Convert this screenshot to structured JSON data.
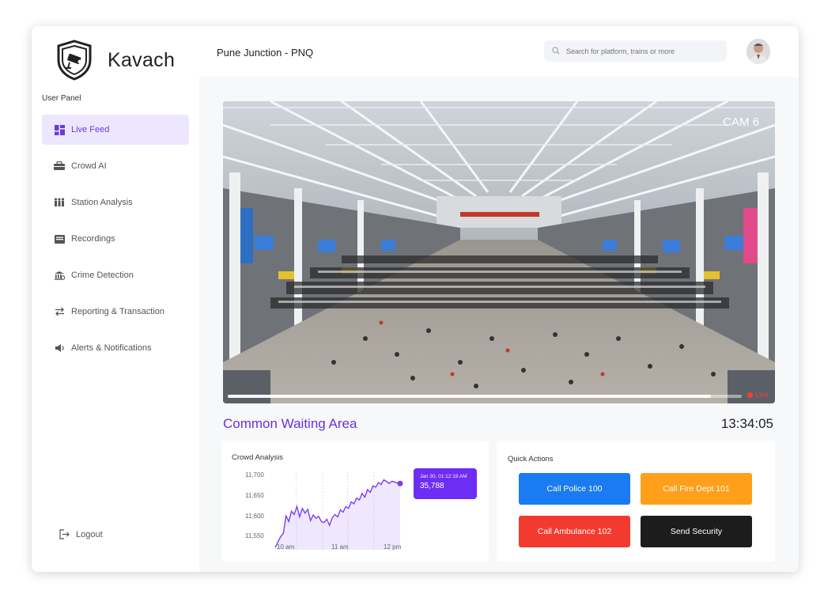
{
  "app": {
    "name": "Kavach"
  },
  "sidebar": {
    "panel_label": "User Panel",
    "items": [
      {
        "label": "Live Feed",
        "icon": "dashboard-icon",
        "active": true
      },
      {
        "label": "Crowd AI",
        "icon": "crowd-icon"
      },
      {
        "label": "Station Analysis",
        "icon": "people-analysis-icon"
      },
      {
        "label": "Recordings",
        "icon": "recordings-icon"
      },
      {
        "label": "Crime Detection",
        "icon": "crime-icon"
      },
      {
        "label": "Reporting & Transaction",
        "icon": "swap-arrows-icon"
      },
      {
        "label": "Alerts & Notifications",
        "icon": "alert-icon"
      }
    ],
    "logout_label": "Logout"
  },
  "header": {
    "station": "Pune Junction - PNQ",
    "search_placeholder": "Search for platform, trains or more"
  },
  "feed": {
    "camera": "CAM 6",
    "live_label": "Live",
    "progress": 0.94,
    "area": "Common Waiting Area",
    "time": "13:34:05"
  },
  "crowd": {
    "title": "Crowd Analysis",
    "tooltip_date": "Jan 30, 01:12:18 AM",
    "tooltip_value": "35,788",
    "chart_data": {
      "type": "area",
      "x": [
        0.0,
        0.1,
        0.15,
        0.2,
        0.25,
        0.3,
        0.35,
        0.4,
        0.45,
        0.5,
        0.55,
        0.6,
        0.65,
        0.7,
        0.75,
        0.8,
        0.85,
        0.9,
        0.95,
        1.0,
        1.05,
        1.1,
        1.15,
        1.2,
        1.25,
        1.3,
        1.35,
        1.4,
        1.45,
        1.5,
        1.55,
        1.6,
        1.65,
        1.7,
        1.75,
        1.8,
        1.85,
        1.9,
        1.95,
        2.0,
        2.05,
        2.1,
        2.15,
        2.2,
        2.25,
        2.3
      ],
      "values": [
        11545,
        11568,
        11575,
        11612,
        11600,
        11622,
        11615,
        11632,
        11610,
        11628,
        11618,
        11626,
        11602,
        11614,
        11607,
        11611,
        11600,
        11598,
        11605,
        11592,
        11608,
        11615,
        11610,
        11625,
        11620,
        11632,
        11628,
        11642,
        11638,
        11650,
        11646,
        11660,
        11652,
        11668,
        11662,
        11676,
        11673,
        11683,
        11679,
        11689,
        11685,
        11681,
        11686,
        11684,
        11682,
        11681
      ],
      "xticks": [
        "10 am",
        "11 am",
        "12 pm"
      ],
      "yticks": [
        "11,700",
        "11,650",
        "11,600",
        "11,550"
      ],
      "ylim": [
        11540,
        11705
      ],
      "color": "#7b3ff2"
    }
  },
  "actions": {
    "title": "Quick Actions",
    "buttons": [
      {
        "label": "Call Police 100",
        "color": "#1a7bf2"
      },
      {
        "label": "Call Fire Dept 101",
        "color": "#ff9f1a"
      },
      {
        "label": "Call Ambulance 102",
        "color": "#f23a2f"
      },
      {
        "label": "Send Security",
        "color": "#1c1c1c"
      }
    ]
  }
}
